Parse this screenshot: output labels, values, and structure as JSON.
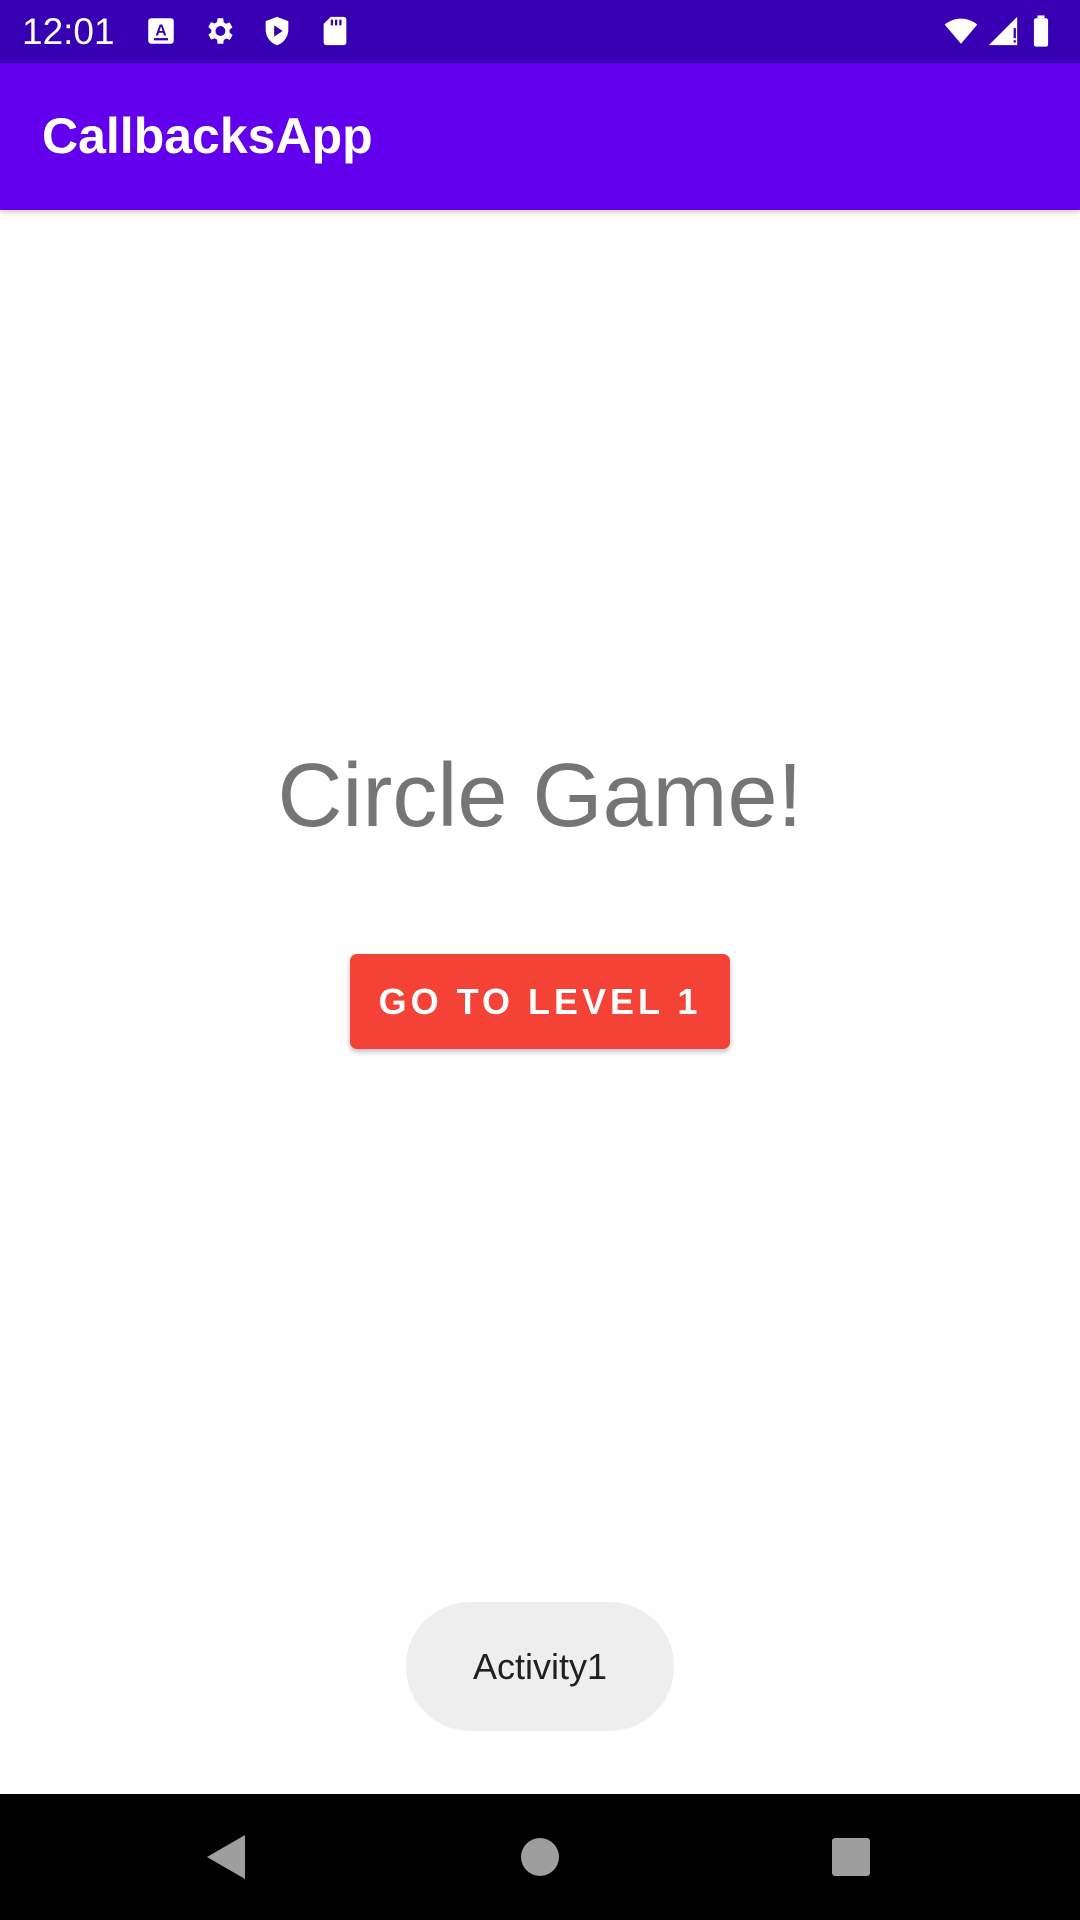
{
  "status_bar": {
    "time": "12:01",
    "left_icons": [
      "keyboard-a-icon",
      "settings-gear-icon",
      "play-protect-icon",
      "sd-card-icon"
    ],
    "right_icons": [
      "wifi-icon",
      "cellular-signal-icon",
      "battery-icon"
    ]
  },
  "app_bar": {
    "title": "CallbacksApp"
  },
  "main": {
    "title": "Circle Game!",
    "button_label": "GO TO LEVEL 1"
  },
  "toast": {
    "text": "Activity1"
  },
  "nav_bar": {
    "icons": [
      "back-icon",
      "home-icon",
      "recents-icon"
    ]
  },
  "colors": {
    "status_bar": "#3700b3",
    "app_bar": "#6200ee",
    "button": "#f44336",
    "title_text": "#757575",
    "toast_bg": "#eeeeee",
    "nav_bar": "#000000"
  }
}
